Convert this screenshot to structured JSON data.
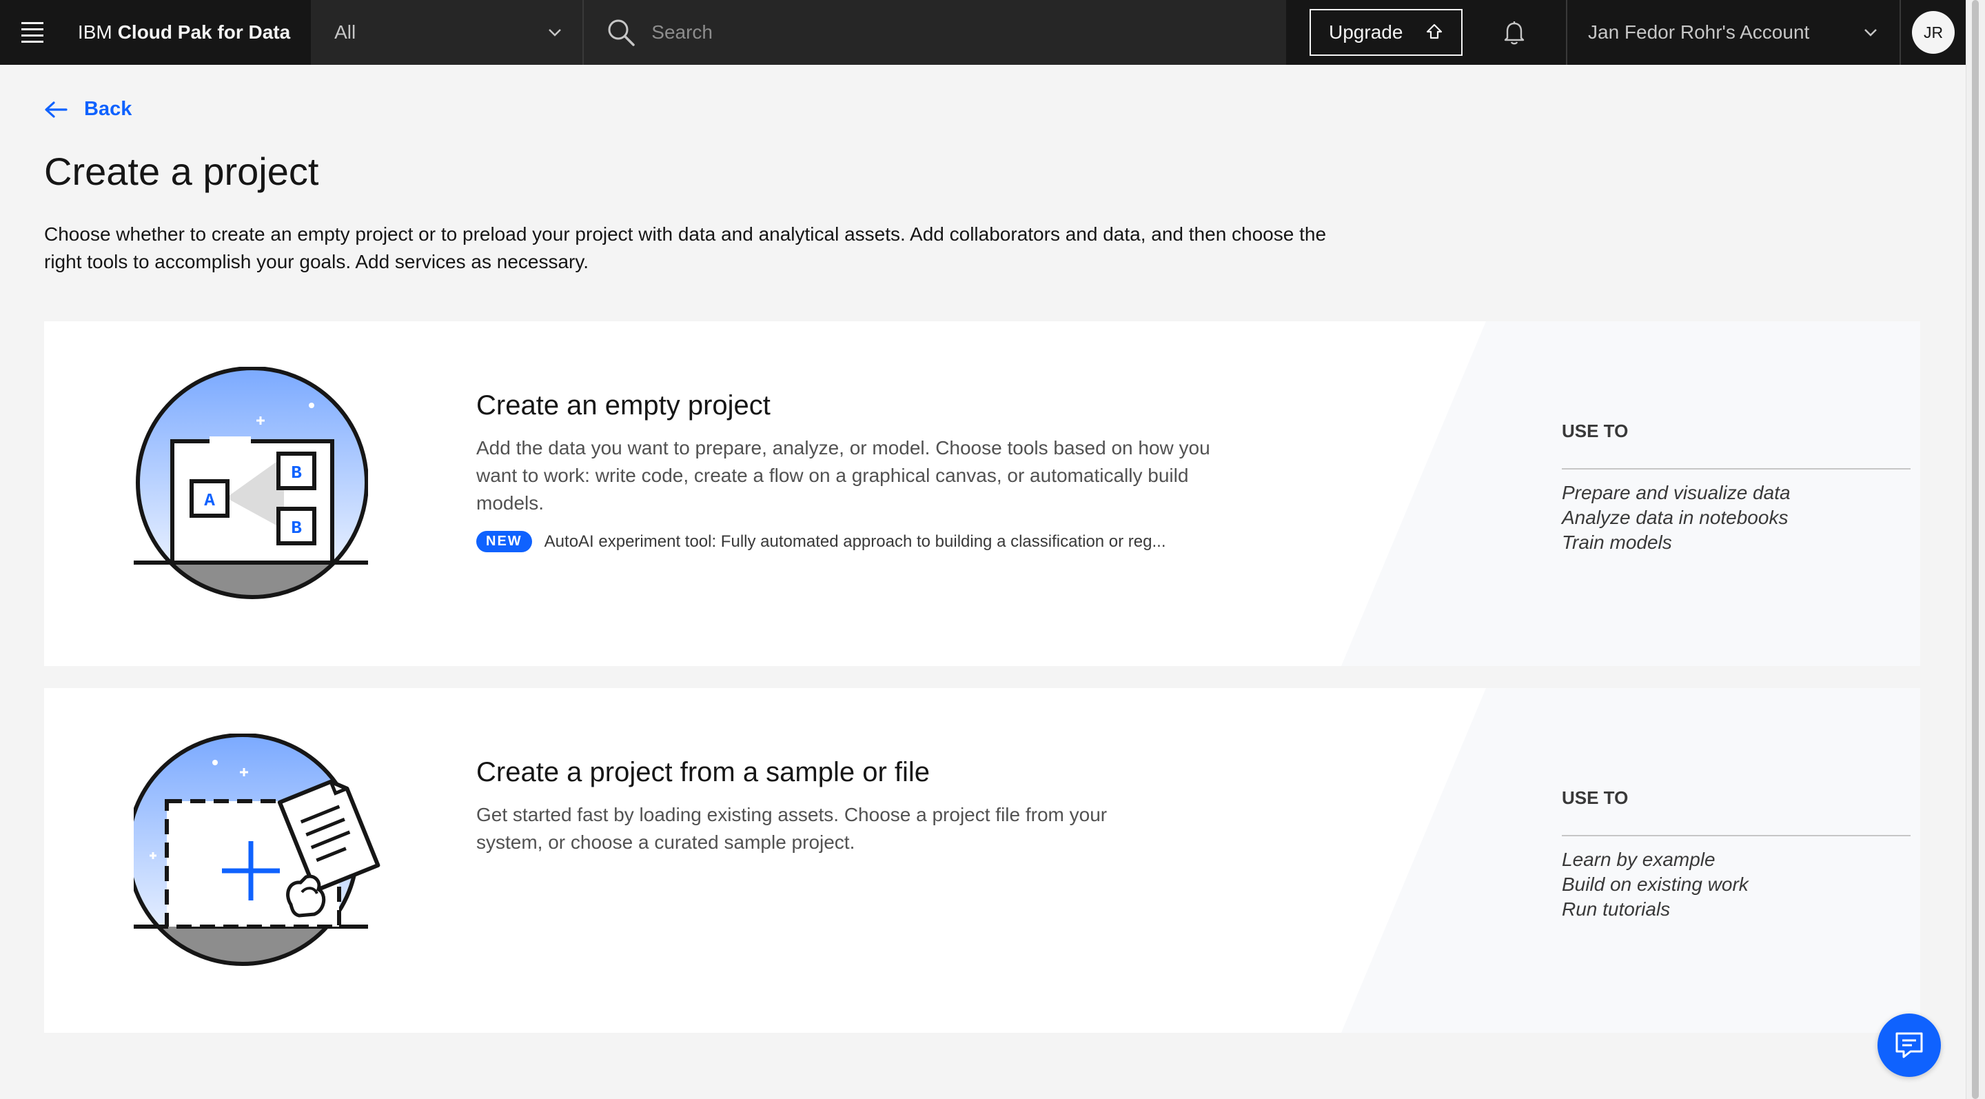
{
  "header": {
    "brand_prefix": "IBM",
    "brand_name": "Cloud Pak for Data",
    "scope_label": "All",
    "search_placeholder": "Search",
    "upgrade_label": "Upgrade",
    "account_label": "Jan Fedor Rohr's Account",
    "avatar_initials": "JR"
  },
  "page": {
    "back_label": "Back",
    "title": "Create a project",
    "intro": "Choose whether to create an empty project or to preload your project with data and analytical assets. Add collaborators and data, and then choose the right tools to accomplish your goals. Add services as necessary."
  },
  "cards": [
    {
      "title": "Create an empty project",
      "description": "Add the data you want to prepare, analyze, or model. Choose tools based on how you want to work: write code, create a flow on a graphical canvas, or automatically build models.",
      "badge": "NEW",
      "badge_text": "AutoAI experiment tool: Fully automated approach to building a classification or reg...",
      "use_to_title": "USE TO",
      "use_to_items": [
        "Prepare and visualize data",
        "Analyze data in notebooks",
        "Train models"
      ],
      "illustration_letters": [
        "A",
        "B",
        "B"
      ]
    },
    {
      "title": "Create a project from a sample or file",
      "description": "Get started fast by loading existing assets. Choose a project file from your system, or choose a curated sample project.",
      "use_to_title": "USE TO",
      "use_to_items": [
        "Learn by example",
        "Build on existing work",
        "Run tutorials"
      ]
    }
  ],
  "colors": {
    "header_bg": "#161616",
    "accent_blue": "#0f62fe",
    "page_bg": "#f4f4f4",
    "card_bg": "#ffffff"
  },
  "icons": {
    "menu": "hamburger-menu-icon",
    "dropdown": "chevron-down-icon",
    "search": "search-icon",
    "upgrade": "upgrade-arrow-icon",
    "notifications": "bell-icon",
    "back": "arrow-left-icon",
    "chat": "chat-icon"
  }
}
